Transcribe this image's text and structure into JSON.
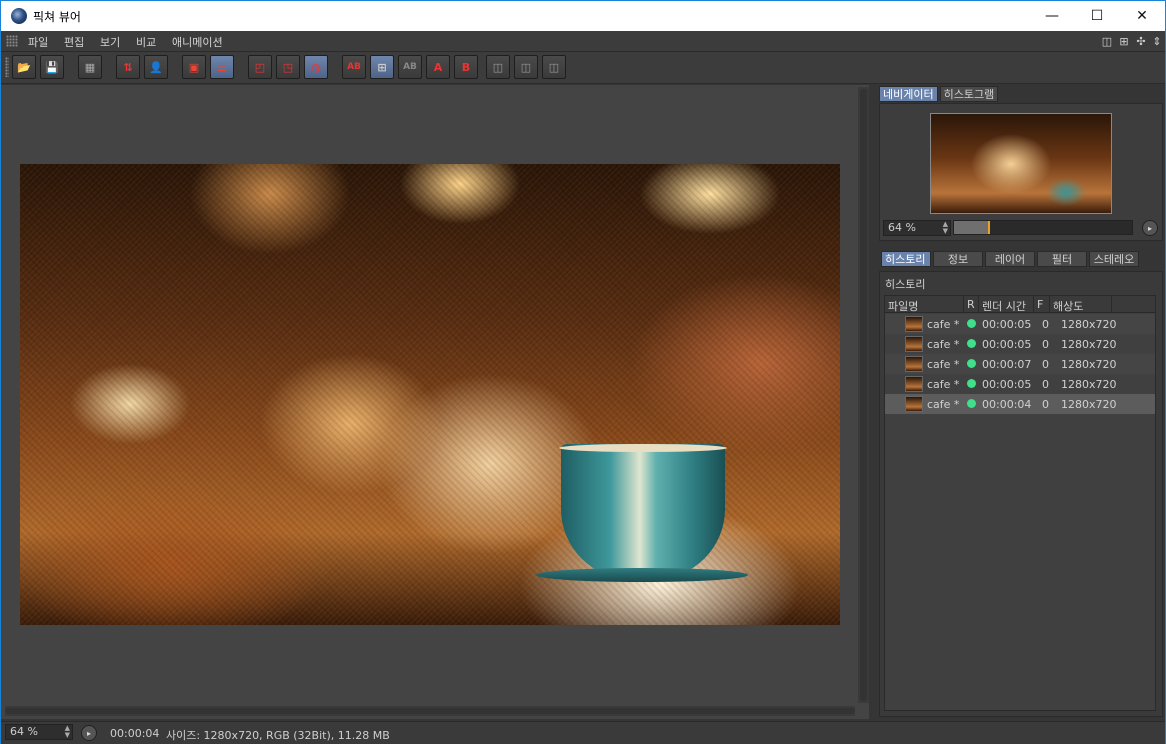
{
  "window": {
    "title": "픽쳐 뷰어",
    "minimize_glyph": "—",
    "maximize_glyph": "☐",
    "close_glyph": "✕"
  },
  "menu": [
    {
      "label": "파일"
    },
    {
      "label": "편집"
    },
    {
      "label": "보기"
    },
    {
      "label": "비교"
    },
    {
      "label": "애니메이션"
    }
  ],
  "toolbar": {
    "buttons": [
      {
        "icon": "open-folder-icon",
        "glyph": "📂"
      },
      {
        "icon": "save-as-icon",
        "glyph": "💾"
      },
      {
        "icon": "grid-icon",
        "glyph": "▦"
      },
      {
        "icon": "move-to-icon",
        "glyph": "⇅"
      },
      {
        "icon": "user-icon",
        "glyph": "👤"
      },
      {
        "icon": "delete-icon",
        "glyph": "▣"
      },
      {
        "icon": "list-icon",
        "glyph": "☰"
      },
      {
        "icon": "region-icon",
        "glyph": "◰"
      },
      {
        "icon": "region-render-icon",
        "glyph": "◳"
      },
      {
        "icon": "channels-icon",
        "glyph": "◍"
      },
      {
        "icon": "ab-icon",
        "glyph": "AB"
      },
      {
        "icon": "compare-split-icon",
        "glyph": "⊞"
      },
      {
        "icon": "ab-swap-icon",
        "glyph": "AB"
      },
      {
        "icon": "set-a-icon",
        "glyph": "A"
      },
      {
        "icon": "set-b-icon",
        "glyph": "B"
      },
      {
        "icon": "layout-1-icon",
        "glyph": "◫"
      },
      {
        "icon": "layout-2-icon",
        "glyph": "◫"
      },
      {
        "icon": "layout-3-icon",
        "glyph": "◫"
      }
    ]
  },
  "navigator": {
    "tabs": [
      {
        "label": "네비게이터",
        "active": true
      },
      {
        "label": "히스토그램",
        "active": false
      }
    ],
    "zoom": "64 %",
    "zoom_fraction": 0.19,
    "play_glyph": "▸"
  },
  "history_panel": {
    "tabs": [
      {
        "label": "히스토리",
        "active": true
      },
      {
        "label": "정보",
        "active": false
      },
      {
        "label": "레이어",
        "active": false
      },
      {
        "label": "필터",
        "active": false
      },
      {
        "label": "스테레오",
        "active": false
      }
    ],
    "title": "히스토리",
    "columns": [
      "파일명",
      "R",
      "렌더 시간",
      "F",
      "해상도"
    ],
    "rows": [
      {
        "name": "cafe *",
        "time": "00:00:05",
        "frame": "0",
        "resolution": "1280x720",
        "selected": false
      },
      {
        "name": "cafe *",
        "time": "00:00:05",
        "frame": "0",
        "resolution": "1280x720",
        "selected": false
      },
      {
        "name": "cafe *",
        "time": "00:00:07",
        "frame": "0",
        "resolution": "1280x720",
        "selected": false
      },
      {
        "name": "cafe *",
        "time": "00:00:05",
        "frame": "0",
        "resolution": "1280x720",
        "selected": false
      },
      {
        "name": "cafe *",
        "time": "00:00:04",
        "frame": "0",
        "resolution": "1280x720",
        "selected": true
      }
    ]
  },
  "status": {
    "zoom": "64 %",
    "play_glyph": "▸",
    "time": "00:00:04",
    "info": "사이즈: 1280x720, RGB (32Bit), 11.28 MB"
  },
  "colors": {
    "accent": "#6a83ad",
    "render_dot": "#3ee08a",
    "slider_knob": "#f0a020"
  }
}
